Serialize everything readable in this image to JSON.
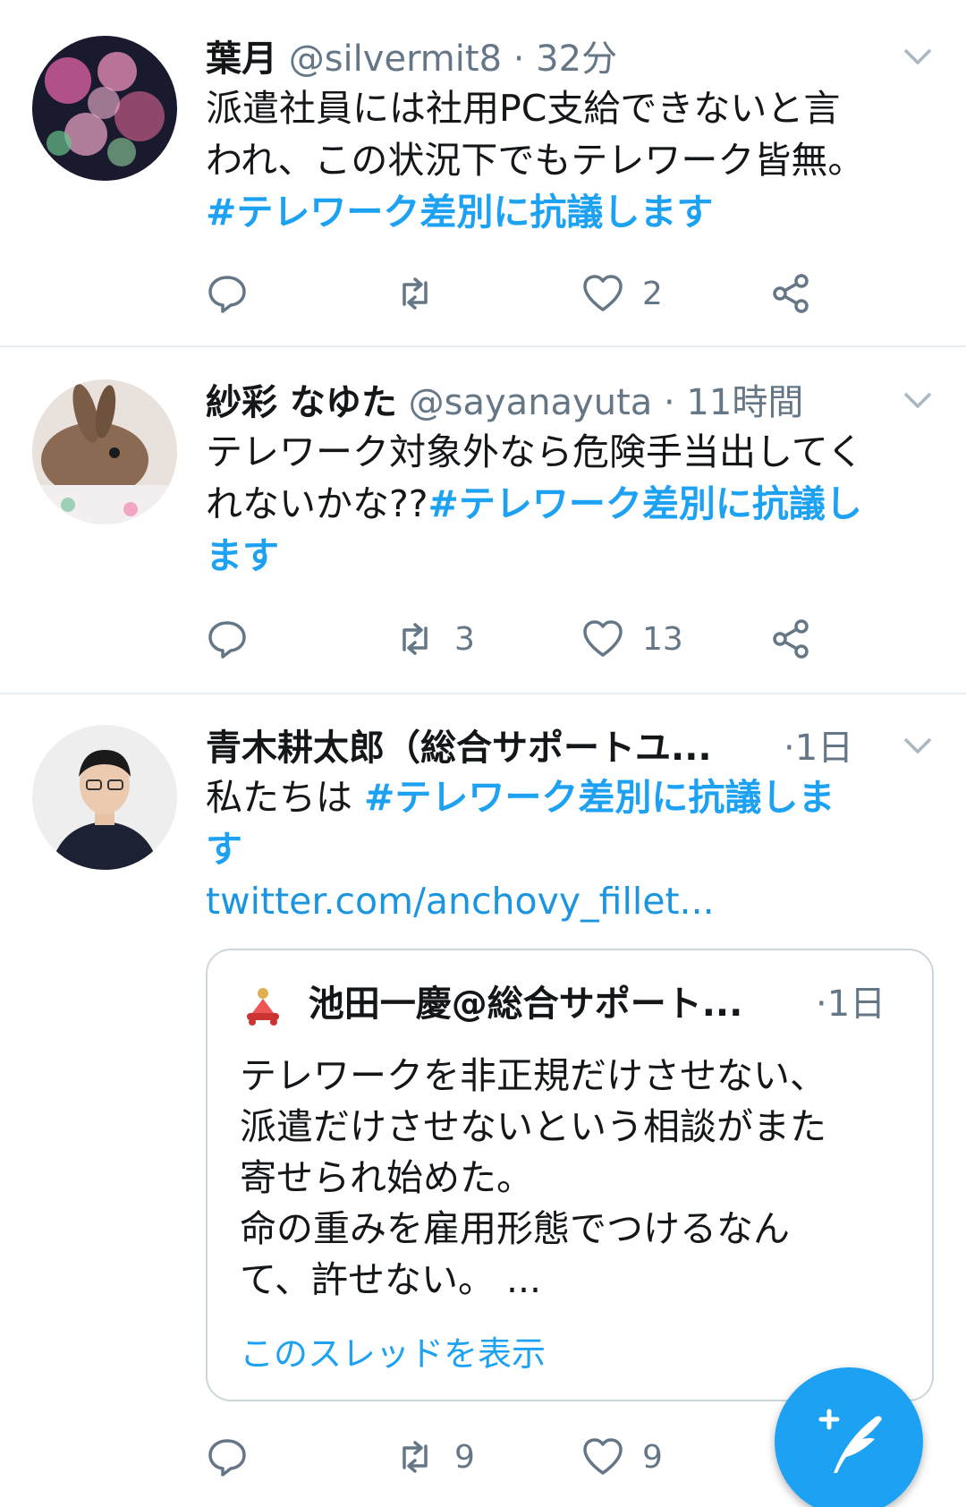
{
  "tweets": [
    {
      "name": "葉月",
      "handle": "@silvermit8",
      "time": "· 32分",
      "text_lines": [
        "派遣社員には社用PC支給できないと言",
        "われ、この状況下でもテレワーク皆無。"
      ],
      "hashtag": "#テレワーク差別に抗議します",
      "retweets": "",
      "likes": "2"
    },
    {
      "name": "紗彩 なゆた",
      "handle": "@sayanayuta",
      "time": "· 11時間",
      "text_line1": "テレワーク対象外なら危険手当出してく",
      "text_prefix": "れないかな??",
      "hashtag_a": "#テレワーク差別に抗議し",
      "hashtag_b": "ます",
      "retweets": "3",
      "likes": "13"
    },
    {
      "name": "青木耕太郎（総合サポートユ...",
      "time": "·1日",
      "text_prefix": "私たちは ",
      "hashtag_a": "#テレワーク差別に抗議しま",
      "hashtag_b": "す",
      "link": "twitter.com/anchovy_fillet...",
      "retweets": "9",
      "likes": "9",
      "quote": {
        "name": "池田一慶@総合サポート...",
        "time": "·1日",
        "lines": [
          "テレワークを非正規だけさせない、",
          "派遣だけさせないという相談がまた",
          "寄せられ始めた。",
          "命の重みを雇用形態でつけるなん",
          "て、許せない。 ..."
        ],
        "show_thread": "このスレッドを表示"
      }
    }
  ],
  "colors": {
    "accent": "#1da1f2",
    "text": "#14171a",
    "muted": "#657786",
    "border": "#e6ecf0"
  }
}
